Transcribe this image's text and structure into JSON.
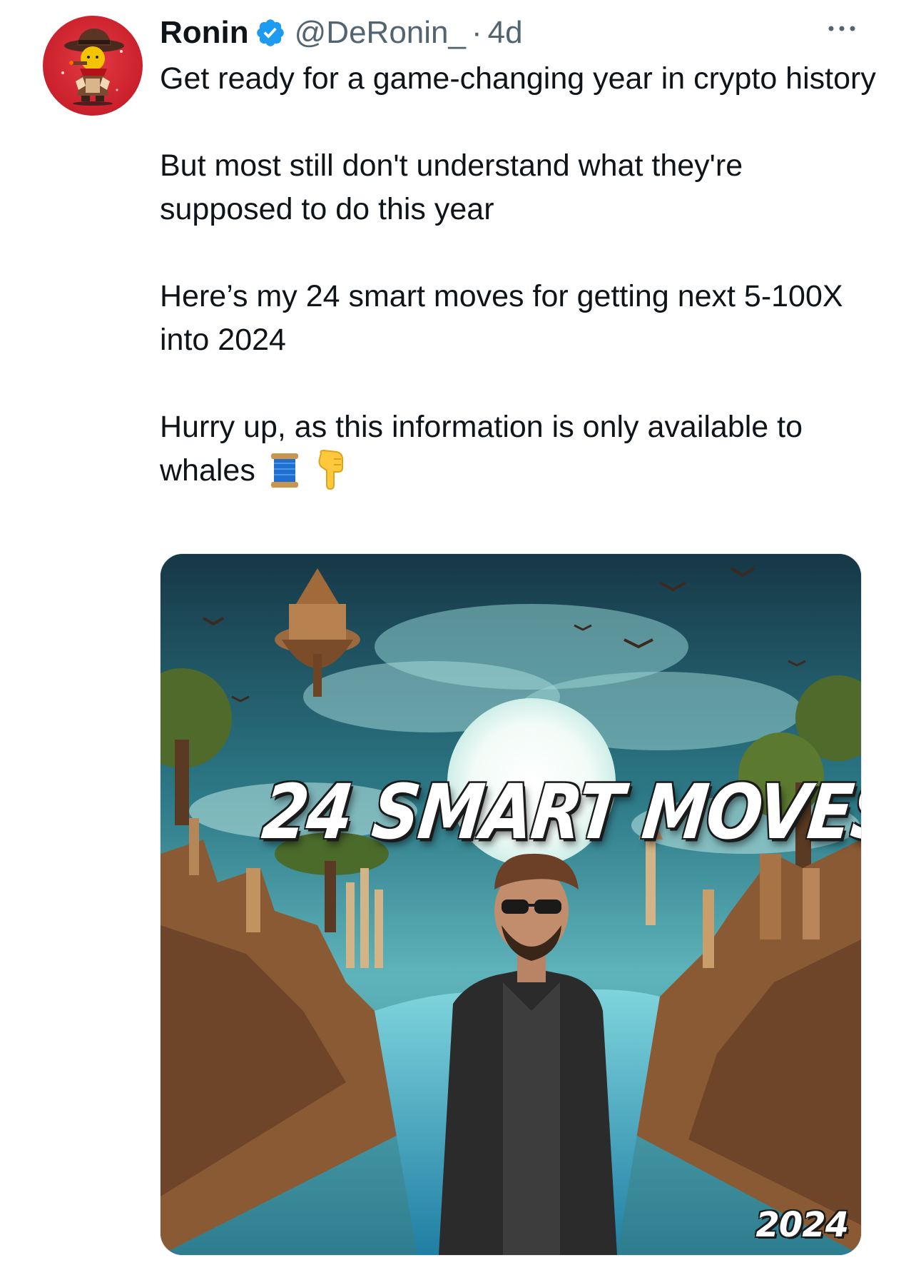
{
  "author": {
    "name": "Ronin",
    "handle": "@DeRonin_",
    "separator": "·",
    "time": "4d",
    "verified_color": "#1d9bf0",
    "avatar_bg_color": "#c9202b"
  },
  "tweet": {
    "paragraphs": [
      "Get ready for a game-changing year in crypto history",
      "But most still don't understand what they're supposed to do this year",
      "Here’s my 24 smart moves for getting next 5-100X into 2024",
      "Hurry up, as this information is only available to whales"
    ],
    "trailing_icons": [
      "spool-of-thread-icon",
      "backhand-index-pointing-down-icon"
    ]
  },
  "media": {
    "headline": "24 SMART MOVES",
    "year": "2024"
  },
  "icons": {
    "more": "more-options-icon",
    "verified": "verified-badge-icon"
  }
}
